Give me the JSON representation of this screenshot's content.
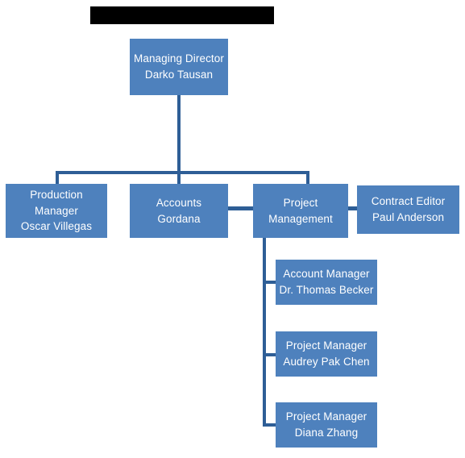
{
  "chart_data": {
    "type": "diagram",
    "diagram_type": "organizational-chart",
    "title": "",
    "title_redacted": true,
    "box_fill_color": "#4E81BD",
    "connector_color": "#2E5E96",
    "text_color": "#FFFFFF",
    "background_color": "#FFFFFF",
    "nodes": [
      {
        "id": "md",
        "role": "Managing Director",
        "name": "Darko Tausan",
        "level": 1
      },
      {
        "id": "production",
        "role": "Production Manager",
        "name": "Oscar Villegas",
        "level": 2
      },
      {
        "id": "accounts",
        "role": "Accounts",
        "name": "Gordana",
        "level": 2
      },
      {
        "id": "projmgmt",
        "role": "Project Management",
        "name": "",
        "level": 2
      },
      {
        "id": "contract",
        "role": "Contract Editor",
        "name": "Paul Anderson",
        "level": 2
      },
      {
        "id": "acctmgr",
        "role": "Account Manager",
        "name": "Dr. Thomas Becker",
        "level": 3
      },
      {
        "id": "pm1",
        "role": "Project Manager",
        "name": "Audrey Pak Chen",
        "level": 3
      },
      {
        "id": "pm2",
        "role": "Project Manager",
        "name": "Diana Zhang",
        "level": 3
      }
    ],
    "edges": [
      {
        "from": "md",
        "to": "production"
      },
      {
        "from": "md",
        "to": "accounts"
      },
      {
        "from": "md",
        "to": "projmgmt"
      },
      {
        "from": "accounts",
        "to": "projmgmt"
      },
      {
        "from": "projmgmt",
        "to": "contract"
      },
      {
        "from": "projmgmt",
        "to": "acctmgr"
      },
      {
        "from": "projmgmt",
        "to": "pm1"
      },
      {
        "from": "projmgmt",
        "to": "pm2"
      }
    ]
  },
  "header": {
    "redacted_title": ""
  },
  "boxes": {
    "managing_director": {
      "role": "Managing Director",
      "name": "Darko Tausan"
    },
    "production_manager": {
      "role_line1": "Production",
      "role_line2": "Manager",
      "name": "Oscar Villegas"
    },
    "accounts": {
      "role": "Accounts",
      "name": "Gordana"
    },
    "project_management": {
      "role_line1": "Project",
      "role_line2": "Management"
    },
    "contract_editor": {
      "role": "Contract Editor",
      "name": "Paul Anderson"
    },
    "account_manager": {
      "role": "Account Manager",
      "name": "Dr. Thomas Becker"
    },
    "project_manager_1": {
      "role": "Project Manager",
      "name": "Audrey Pak Chen"
    },
    "project_manager_2": {
      "role": "Project Manager",
      "name": "Diana Zhang"
    }
  }
}
